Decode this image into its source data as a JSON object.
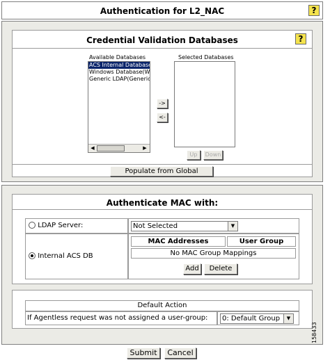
{
  "header": {
    "title": "Authentication for L2_NAC",
    "help": "?"
  },
  "credential": {
    "title": "Credential Validation Databases",
    "help": "?",
    "available_label": "Available Databases",
    "selected_label": "Selected Databases",
    "available_items": [
      "ACS Internal Database",
      "Windows Database(Windo",
      "Generic LDAP(Generic LI"
    ],
    "move_right": "->",
    "move_left": "<-",
    "up": "Up",
    "down": "Down",
    "populate": "Populate from Global"
  },
  "mac": {
    "title": "Authenticate MAC with:",
    "ldap_label": "LDAP Server:",
    "ldap_value": "Not Selected",
    "internal_label": "Internal ACS DB",
    "col_mac": "MAC Addresses",
    "col_group": "User Group",
    "empty_text": "No MAC Group Mappings",
    "add": "Add",
    "delete": "Delete",
    "default_title": "Default Action",
    "agentless_label": "If Agentless request was not assigned a user-group:",
    "default_group": "0: Default Group"
  },
  "footer": {
    "submit": "Submit",
    "cancel": "Cancel"
  },
  "side_id": "158433"
}
